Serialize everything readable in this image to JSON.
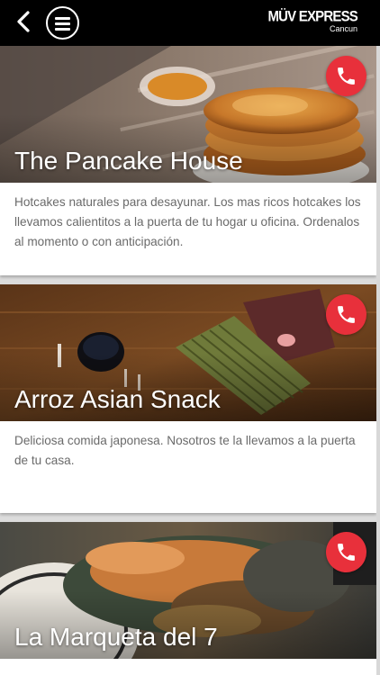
{
  "header": {
    "back_icon": "chevron-left-icon",
    "menu_icon": "hamburger-menu-icon",
    "brand_name": "MÜV EXPRESS",
    "brand_city": "Cancun"
  },
  "colors": {
    "topbar": "#000000",
    "call_button": "#e8303b",
    "description_text": "#6a6a6a",
    "feed_background": "#dcdcdc"
  },
  "restaurants": [
    {
      "name": "The Pancake House",
      "description": "Hotcakes naturales para desayunar. Los mas ricos hotcakes los llevamos calientitos a la puerta de tu hogar u oficina. Ordenalos al momento o con anticipación.",
      "call_icon": "phone-icon"
    },
    {
      "name": "Arroz Asian Snack",
      "description": "Deliciosa comida japonesa. Nosotros te la llevamos a la puerta de tu casa.",
      "call_icon": "phone-icon"
    },
    {
      "name": "La Marqueta del 7",
      "description": "",
      "call_icon": "phone-icon"
    }
  ]
}
